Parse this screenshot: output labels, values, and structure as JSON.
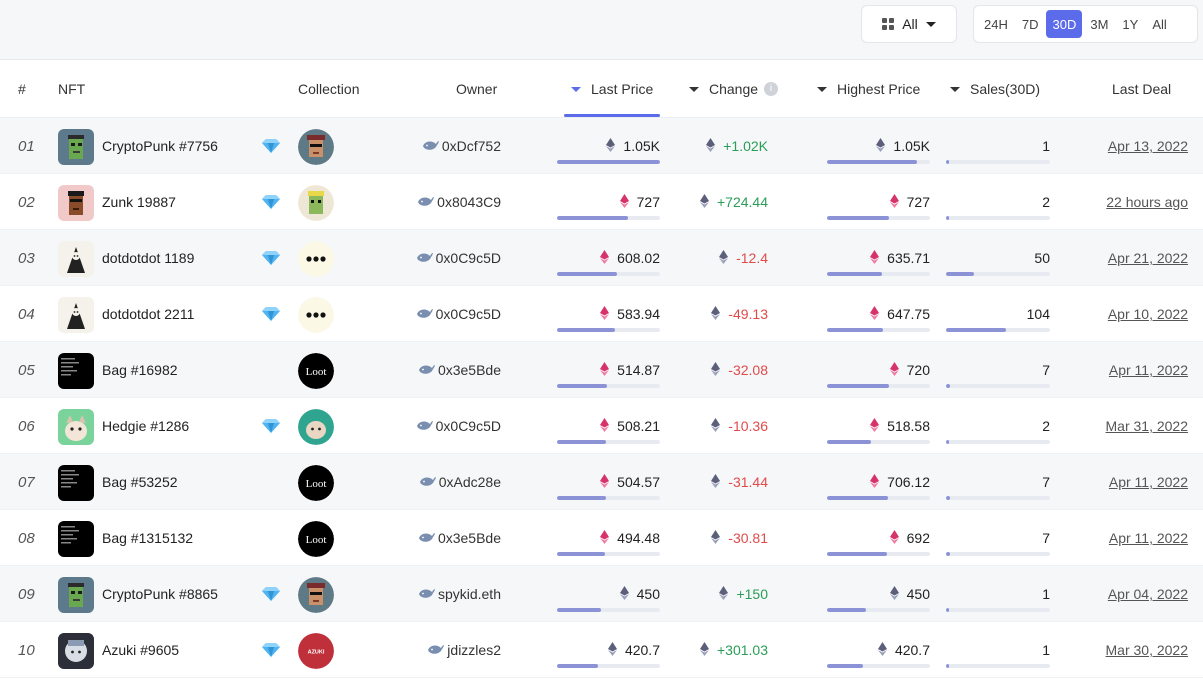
{
  "toolbar": {
    "filter_label": "All",
    "ranges": [
      {
        "label": "24H",
        "active": false
      },
      {
        "label": "7D",
        "active": false
      },
      {
        "label": "30D",
        "active": true
      },
      {
        "label": "3M",
        "active": false
      },
      {
        "label": "1Y",
        "active": false
      },
      {
        "label": "All",
        "active": false
      }
    ]
  },
  "columns": {
    "rank": "#",
    "nft": "NFT",
    "collection": "Collection",
    "owner": "Owner",
    "last_price": "Last Price",
    "change": "Change",
    "highest_price": "Highest Price",
    "sales": "Sales(30D)",
    "last_deal": "Last Deal"
  },
  "colors": {
    "accent": "#5b6bea",
    "positive": "#2a9d57",
    "negative": "#e04a4a",
    "bar_fill": "#8b93d6"
  },
  "rows": [
    {
      "rank": "01",
      "name": "CryptoPunk #7756",
      "diamond": true,
      "collection_icon": "cryptopunks-avatar",
      "owner": "0xDcf752",
      "price": "1.05K",
      "price_eth_color": "purple",
      "change": "+1.02K",
      "change_sign": "pos",
      "highest": "1.05K",
      "highest_eth_color": "purple",
      "sales": "1",
      "deal": "Apr 13, 2022",
      "price_pct": 100,
      "highest_pct": 87,
      "sales_pct": 1
    },
    {
      "rank": "02",
      "name": "Zunk 19887",
      "diamond": true,
      "collection_icon": "zunks-avatar",
      "owner": "0x8043C9",
      "price": "727",
      "price_eth_color": "red",
      "change": "+724.44",
      "change_sign": "pos",
      "highest": "727",
      "highest_eth_color": "red",
      "sales": "2",
      "deal": "22 hours ago",
      "price_pct": 69,
      "highest_pct": 60,
      "sales_pct": 2
    },
    {
      "rank": "03",
      "name": "dotdotdot 1189",
      "diamond": true,
      "collection_icon": "dotdotdot-avatar",
      "owner": "0x0C9c5D",
      "price": "608.02",
      "price_eth_color": "red",
      "change": "-12.4",
      "change_sign": "neg",
      "highest": "635.71",
      "highest_eth_color": "red",
      "sales": "50",
      "deal": "Apr 21, 2022",
      "price_pct": 58,
      "highest_pct": 53,
      "sales_pct": 27
    },
    {
      "rank": "04",
      "name": "dotdotdot 2211",
      "diamond": true,
      "collection_icon": "dotdotdot-avatar",
      "owner": "0x0C9c5D",
      "price": "583.94",
      "price_eth_color": "red",
      "change": "-49.13",
      "change_sign": "neg",
      "highest": "647.75",
      "highest_eth_color": "red",
      "sales": "104",
      "deal": "Apr 10, 2022",
      "price_pct": 56,
      "highest_pct": 54,
      "sales_pct": 58
    },
    {
      "rank": "05",
      "name": "Bag #16982",
      "diamond": false,
      "collection_icon": "loot-avatar",
      "owner": "0x3e5Bde",
      "price": "514.87",
      "price_eth_color": "red",
      "change": "-32.08",
      "change_sign": "neg",
      "highest": "720",
      "highest_eth_color": "red",
      "sales": "7",
      "deal": "Apr 11, 2022",
      "price_pct": 49,
      "highest_pct": 60,
      "sales_pct": 4
    },
    {
      "rank": "06",
      "name": "Hedgie #1286",
      "diamond": true,
      "collection_icon": "hedgies-avatar",
      "owner": "0x0C9c5D",
      "price": "508.21",
      "price_eth_color": "red",
      "change": "-10.36",
      "change_sign": "neg",
      "highest": "518.58",
      "highest_eth_color": "red",
      "sales": "2",
      "deal": "Mar 31, 2022",
      "price_pct": 48,
      "highest_pct": 43,
      "sales_pct": 2
    },
    {
      "rank": "07",
      "name": "Bag #53252",
      "diamond": false,
      "collection_icon": "loot-avatar",
      "owner": "0xAdc28e",
      "price": "504.57",
      "price_eth_color": "red",
      "change": "-31.44",
      "change_sign": "neg",
      "highest": "706.12",
      "highest_eth_color": "red",
      "sales": "7",
      "deal": "Apr 11, 2022",
      "price_pct": 48,
      "highest_pct": 59,
      "sales_pct": 4
    },
    {
      "rank": "08",
      "name": "Bag #1315132",
      "diamond": false,
      "collection_icon": "loot-avatar",
      "owner": "0x3e5Bde",
      "price": "494.48",
      "price_eth_color": "red",
      "change": "-30.81",
      "change_sign": "neg",
      "highest": "692",
      "highest_eth_color": "red",
      "sales": "7",
      "deal": "Apr 11, 2022",
      "price_pct": 47,
      "highest_pct": 58,
      "sales_pct": 4
    },
    {
      "rank": "09",
      "name": "CryptoPunk #8865",
      "diamond": true,
      "collection_icon": "cryptopunks-avatar",
      "owner": "spykid.eth",
      "price": "450",
      "price_eth_color": "purple",
      "change": "+150",
      "change_sign": "pos",
      "highest": "450",
      "highest_eth_color": "purple",
      "sales": "1",
      "deal": "Apr 04, 2022",
      "price_pct": 43,
      "highest_pct": 38,
      "sales_pct": 1
    },
    {
      "rank": "10",
      "name": "Azuki #9605",
      "diamond": true,
      "collection_icon": "azuki-avatar",
      "owner": "jdizzles2",
      "price": "420.7",
      "price_eth_color": "purple",
      "change": "+301.03",
      "change_sign": "pos",
      "highest": "420.7",
      "highest_eth_color": "purple",
      "sales": "1",
      "deal": "Mar 30, 2022",
      "price_pct": 40,
      "highest_pct": 35,
      "sales_pct": 1
    }
  ],
  "collection_labels": {
    "loot": "Loot",
    "azuki": "AZUKI"
  }
}
